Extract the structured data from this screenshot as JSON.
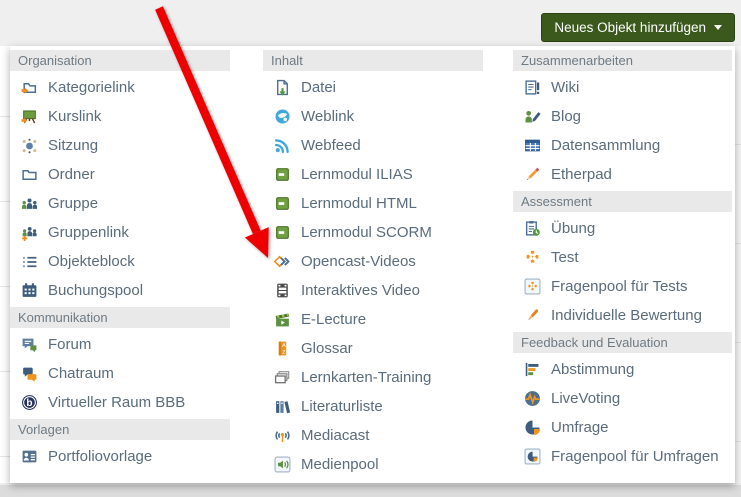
{
  "page": {
    "add_button": {
      "label": "Neues Objekt hinzufügen"
    }
  },
  "menu": {
    "columns": [
      {
        "entries": [
          {
            "type": "header",
            "label": "Organisation"
          },
          {
            "type": "item",
            "label": "Kategorielink",
            "icon": "category-link-icon"
          },
          {
            "type": "item",
            "label": "Kurslink",
            "icon": "course-link-icon"
          },
          {
            "type": "item",
            "label": "Sitzung",
            "icon": "session-icon"
          },
          {
            "type": "item",
            "label": "Ordner",
            "icon": "folder-icon"
          },
          {
            "type": "item",
            "label": "Gruppe",
            "icon": "group-icon"
          },
          {
            "type": "item",
            "label": "Gruppenlink",
            "icon": "group-link-icon"
          },
          {
            "type": "item",
            "label": "Objekteblock",
            "icon": "item-block-icon"
          },
          {
            "type": "item",
            "label": "Buchungspool",
            "icon": "booking-pool-icon"
          },
          {
            "type": "header",
            "label": "Kommunikation"
          },
          {
            "type": "item",
            "label": "Forum",
            "icon": "forum-icon"
          },
          {
            "type": "item",
            "label": "Chatraum",
            "icon": "chatroom-icon"
          },
          {
            "type": "item",
            "label": "Virtueller Raum BBB",
            "icon": "bbb-icon"
          },
          {
            "type": "header",
            "label": "Vorlagen"
          },
          {
            "type": "item",
            "label": "Portfoliovorlage",
            "icon": "portfolio-template-icon"
          }
        ]
      },
      {
        "entries": [
          {
            "type": "header",
            "label": "Inhalt"
          },
          {
            "type": "item",
            "label": "Datei",
            "icon": "file-download-icon"
          },
          {
            "type": "item",
            "label": "Weblink",
            "icon": "weblink-globe-icon"
          },
          {
            "type": "item",
            "label": "Webfeed",
            "icon": "webfeed-rss-icon"
          },
          {
            "type": "item",
            "label": "Lernmodul ILIAS",
            "icon": "learning-module-icon"
          },
          {
            "type": "item",
            "label": "Lernmodul HTML",
            "icon": "learning-module-icon"
          },
          {
            "type": "item",
            "label": "Lernmodul SCORM",
            "icon": "learning-module-icon"
          },
          {
            "type": "item",
            "label": "Opencast-Videos",
            "icon": "opencast-icon"
          },
          {
            "type": "item",
            "label": "Interaktives Video",
            "icon": "interactive-video-icon"
          },
          {
            "type": "item",
            "label": "E-Lecture",
            "icon": "e-lecture-icon"
          },
          {
            "type": "item",
            "label": "Glossar",
            "icon": "glossary-icon"
          },
          {
            "type": "item",
            "label": "Lernkarten-Training",
            "icon": "flashcards-icon"
          },
          {
            "type": "item",
            "label": "Literaturliste",
            "icon": "bibliography-icon"
          },
          {
            "type": "item",
            "label": "Mediacast",
            "icon": "mediacast-icon"
          },
          {
            "type": "item",
            "label": "Medienpool",
            "icon": "media-pool-icon"
          }
        ]
      },
      {
        "entries": [
          {
            "type": "header",
            "label": "Zusammenarbeiten"
          },
          {
            "type": "item",
            "label": "Wiki",
            "icon": "wiki-icon"
          },
          {
            "type": "item",
            "label": "Blog",
            "icon": "blog-icon"
          },
          {
            "type": "item",
            "label": "Datensammlung",
            "icon": "data-collection-icon"
          },
          {
            "type": "item",
            "label": "Etherpad",
            "icon": "etherpad-pencil-icon"
          },
          {
            "type": "header",
            "label": "Assessment"
          },
          {
            "type": "item",
            "label": "Übung",
            "icon": "exercise-icon"
          },
          {
            "type": "item",
            "label": "Test",
            "icon": "test-puzzle-icon"
          },
          {
            "type": "item",
            "label": "Fragenpool für Tests",
            "icon": "question-pool-tests-icon"
          },
          {
            "type": "item",
            "label": "Individuelle Bewertung",
            "icon": "individual-assessment-icon"
          },
          {
            "type": "header",
            "label": "Feedback und Evaluation"
          },
          {
            "type": "item",
            "label": "Abstimmung",
            "icon": "poll-bars-icon"
          },
          {
            "type": "item",
            "label": "LiveVoting",
            "icon": "livevoting-icon"
          },
          {
            "type": "item",
            "label": "Umfrage",
            "icon": "survey-pie-icon"
          },
          {
            "type": "item",
            "label": "Fragenpool für Umfragen",
            "icon": "question-pool-surveys-icon"
          }
        ]
      }
    ]
  },
  "annotation": {
    "arrow_color": "#ee0404",
    "target_label": "Opencast-Videos"
  },
  "colors": {
    "button_green": "#3c591d",
    "section_header_bg": "#e9e9e9",
    "item_text": "#5b6c7c"
  }
}
